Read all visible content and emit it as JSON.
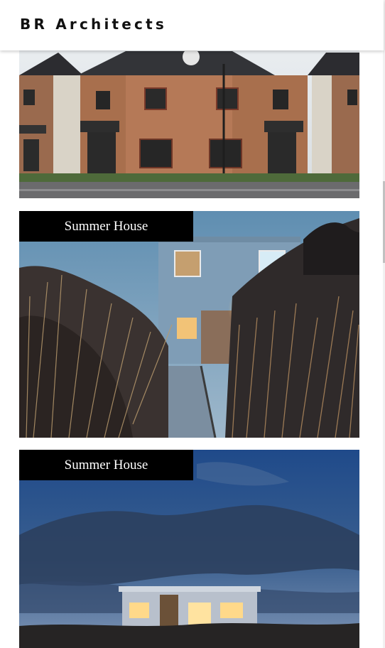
{
  "header": {
    "brand": "BR Architects"
  },
  "projects": [
    {
      "title": ""
    },
    {
      "title": "Summer House"
    },
    {
      "title": "Summer House"
    }
  ]
}
